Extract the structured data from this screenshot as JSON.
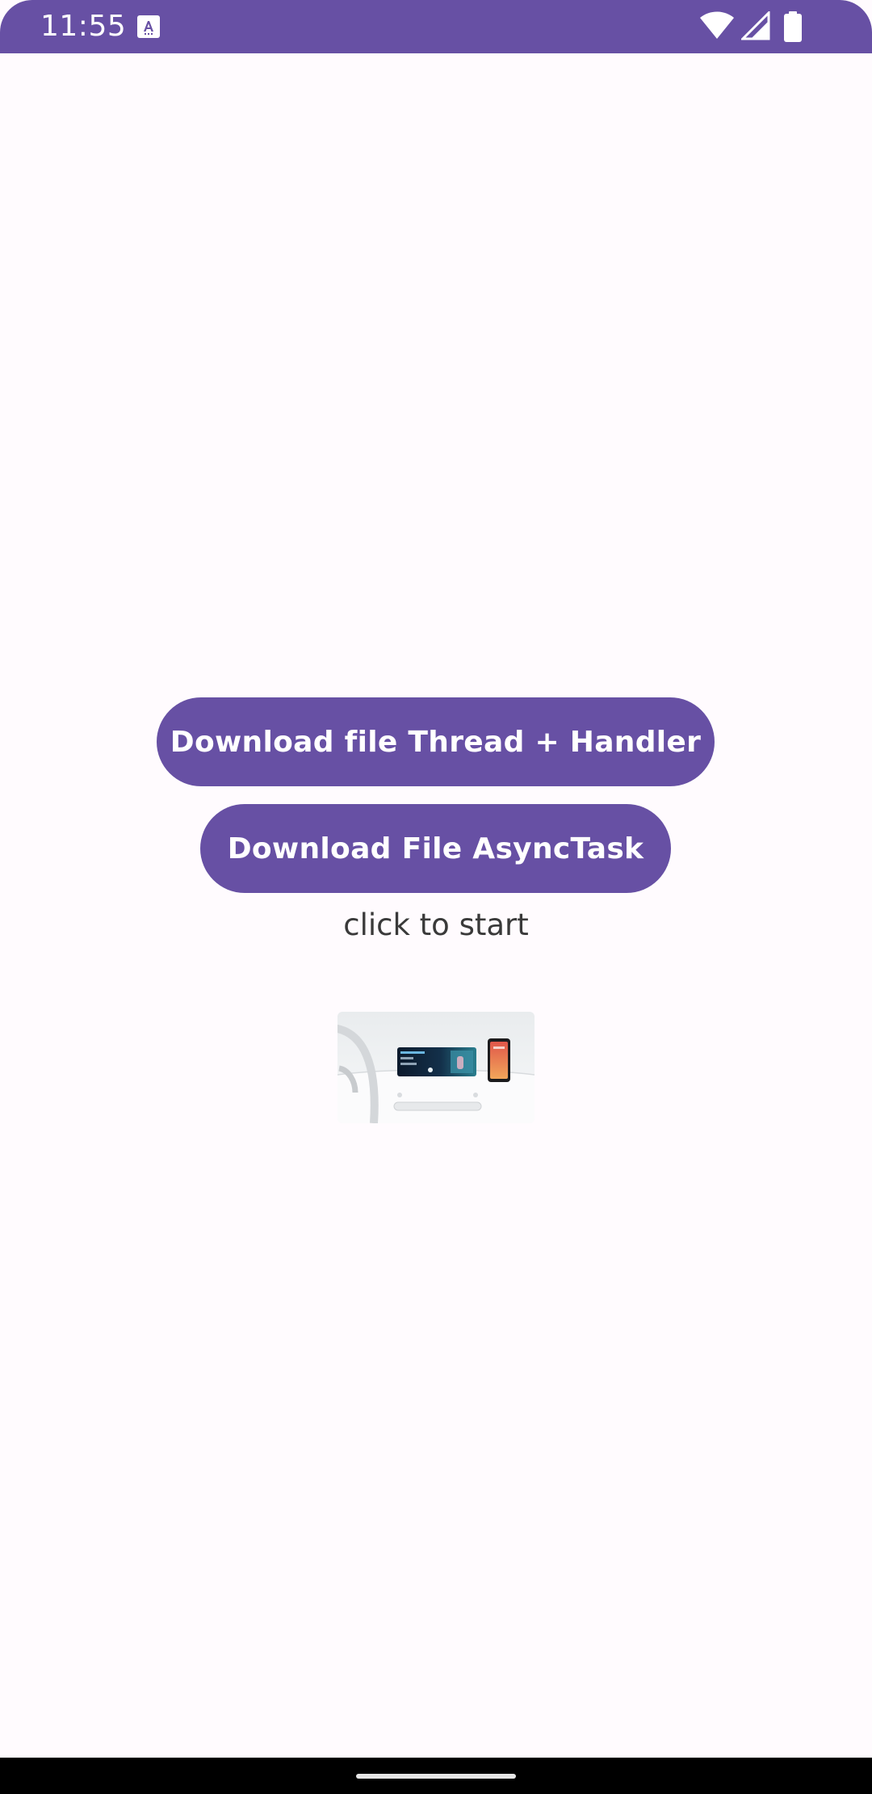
{
  "status_bar": {
    "time": "11:55",
    "notification_icon": "font-download-icon",
    "wifi_icon": "wifi-icon",
    "signal_icon": "cell-signal-icon",
    "battery_icon": "battery-icon",
    "background_color": "#6750a4"
  },
  "main": {
    "thread_button_label": "Download file Thread + Handler",
    "asynctask_button_label": "Download File AsyncTask",
    "status_text": "click to start",
    "downloaded_image": "car-dashboard-phone-image"
  },
  "theme": {
    "primary": "#6750a4",
    "on_primary": "#ffffff",
    "background": "#fffbfe"
  }
}
